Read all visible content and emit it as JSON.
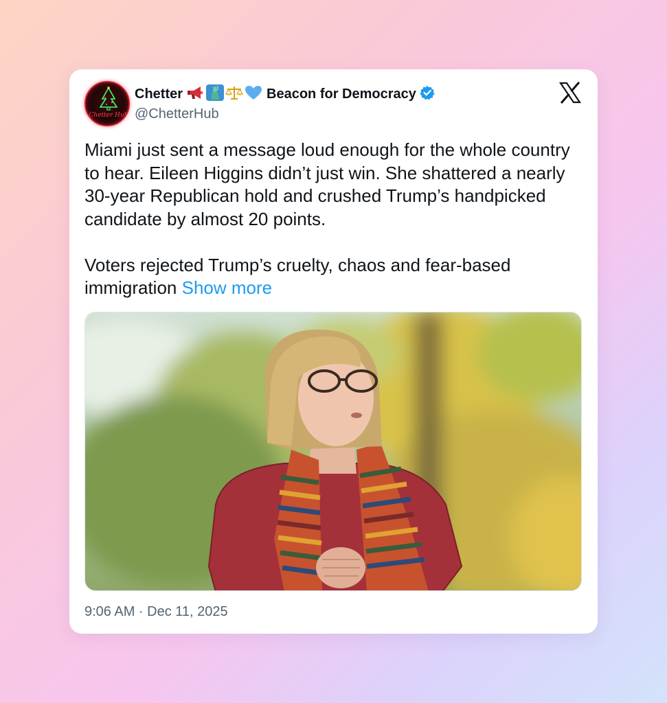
{
  "tweet": {
    "author": {
      "name": "Chetter",
      "emojis": [
        "megaphone",
        "statue-of-liberty",
        "balance-scale",
        "blue-heart"
      ],
      "name_suffix": "Beacon for Democracy",
      "handle": "@ChetterHub",
      "verified": true,
      "avatar_text": "Chetter Hub"
    },
    "platform_icon": "x-logo",
    "text": {
      "paragraph1": "Miami just sent a message loud enough for the whole country to hear. Eileen Higgins didn’t just win. She shattered a nearly 30-year Republican hold and crushed Trump’s handpicked candidate by almost 20 points.",
      "paragraph2": "Voters rejected Trump’s cruelty, chaos and fear-based immigration",
      "show_more": "Show more"
    },
    "timestamp": "9:06 AM · Dec 11, 2025"
  },
  "colors": {
    "link": "#1d9bf0",
    "text": "#0f1419",
    "secondary": "#536471",
    "verified": "#1d9bf0"
  }
}
